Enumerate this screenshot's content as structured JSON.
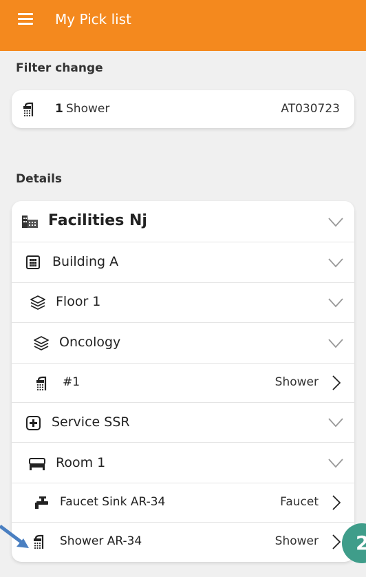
{
  "header": {
    "title": "My Pick list",
    "menu_icon": "hamburger-icon",
    "background": "#f4891e"
  },
  "filter": {
    "section_label": "Filter change",
    "count": "1",
    "item": "Shower",
    "code": "AT030723",
    "icon": "shower-icon"
  },
  "details": {
    "section_label": "Details",
    "rows": [
      {
        "label": "Facilities Nj",
        "icon": "facility-icon",
        "control": "chevron-down"
      },
      {
        "label": "Building A",
        "icon": "building-icon",
        "control": "chevron-down"
      },
      {
        "label": "Floor 1",
        "icon": "layers-icon",
        "control": "chevron-down"
      },
      {
        "label": "Oncology",
        "icon": "layers-icon",
        "control": "chevron-down"
      },
      {
        "label": "#1",
        "type": "Shower",
        "icon": "shower-icon",
        "control": "chevron-right"
      },
      {
        "label": "Service SSR",
        "icon": "medical-plus-icon",
        "control": "chevron-down"
      },
      {
        "label": "Room 1",
        "icon": "bed-icon",
        "control": "chevron-down"
      },
      {
        "label": "Faucet Sink AR-34",
        "type": "Faucet",
        "icon": "faucet-icon",
        "control": "chevron-right"
      },
      {
        "label": "Shower AR-34",
        "type": "Shower",
        "icon": "shower-icon",
        "control": "chevron-right"
      }
    ]
  },
  "annotation": {
    "badge_text": "2",
    "badge_color": "#3f9d8a",
    "arrow_color": "#4a7fc1"
  }
}
